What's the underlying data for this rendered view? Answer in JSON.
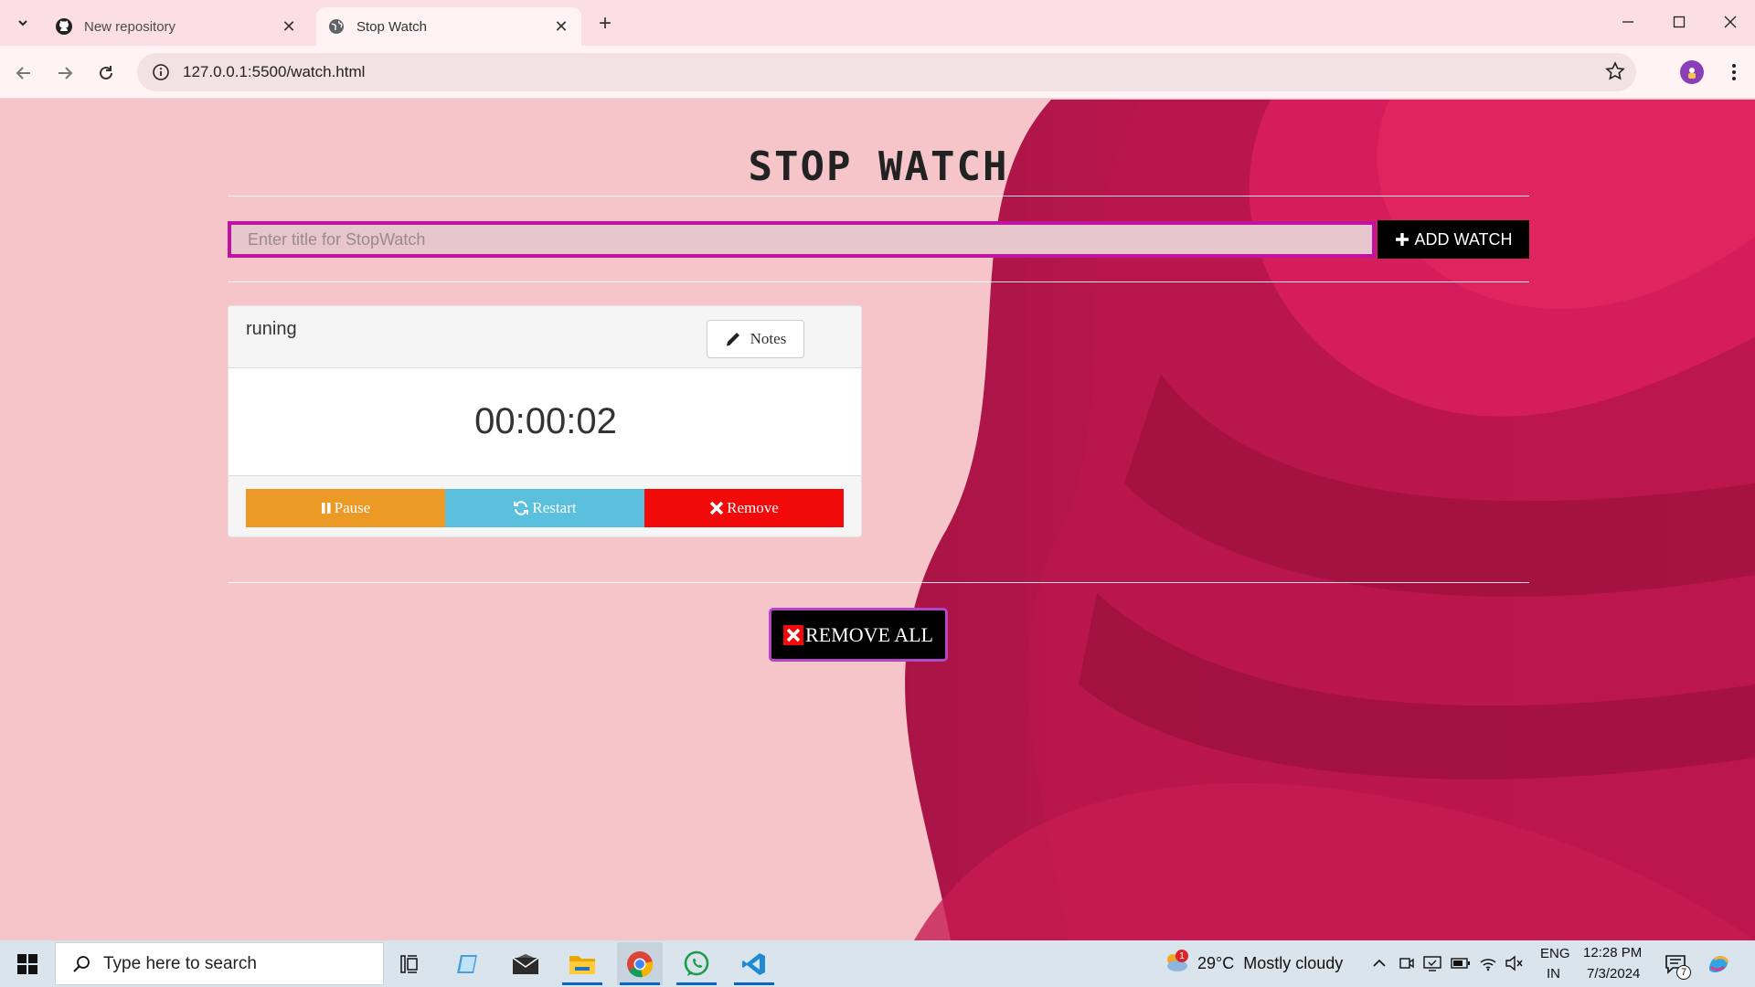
{
  "browser": {
    "tabs": [
      {
        "title": "New repository",
        "icon": "github-icon"
      },
      {
        "title": "Stop Watch",
        "icon": "globe-icon"
      }
    ],
    "url": "127.0.0.1:5500/watch.html"
  },
  "app": {
    "title": "STOP WATCH",
    "input_placeholder": "Enter title for StopWatch",
    "add_label": "ADD WATCH",
    "remove_all_label": "REMOVE ALL",
    "watches": [
      {
        "title": "runing",
        "notes_label": "Notes",
        "time": "00:00:02",
        "pause_label": "Pause",
        "restart_label": "Restart",
        "remove_label": "Remove"
      }
    ]
  },
  "taskbar": {
    "search_placeholder": "Type here to search",
    "weather": "29°C  Mostly cloudy",
    "weather_badge": "1",
    "lang_1": "ENG",
    "lang_2": "IN",
    "time": "12:28 PM",
    "date": "7/3/2024",
    "notif_count": "7"
  },
  "colors": {
    "input_border": "#c013a4",
    "pause": "#ec9a25",
    "restart": "#5bc0de",
    "remove": "#f20a0a",
    "page_bg": "#f5c5c9",
    "art_magenta": "#c8174f"
  }
}
